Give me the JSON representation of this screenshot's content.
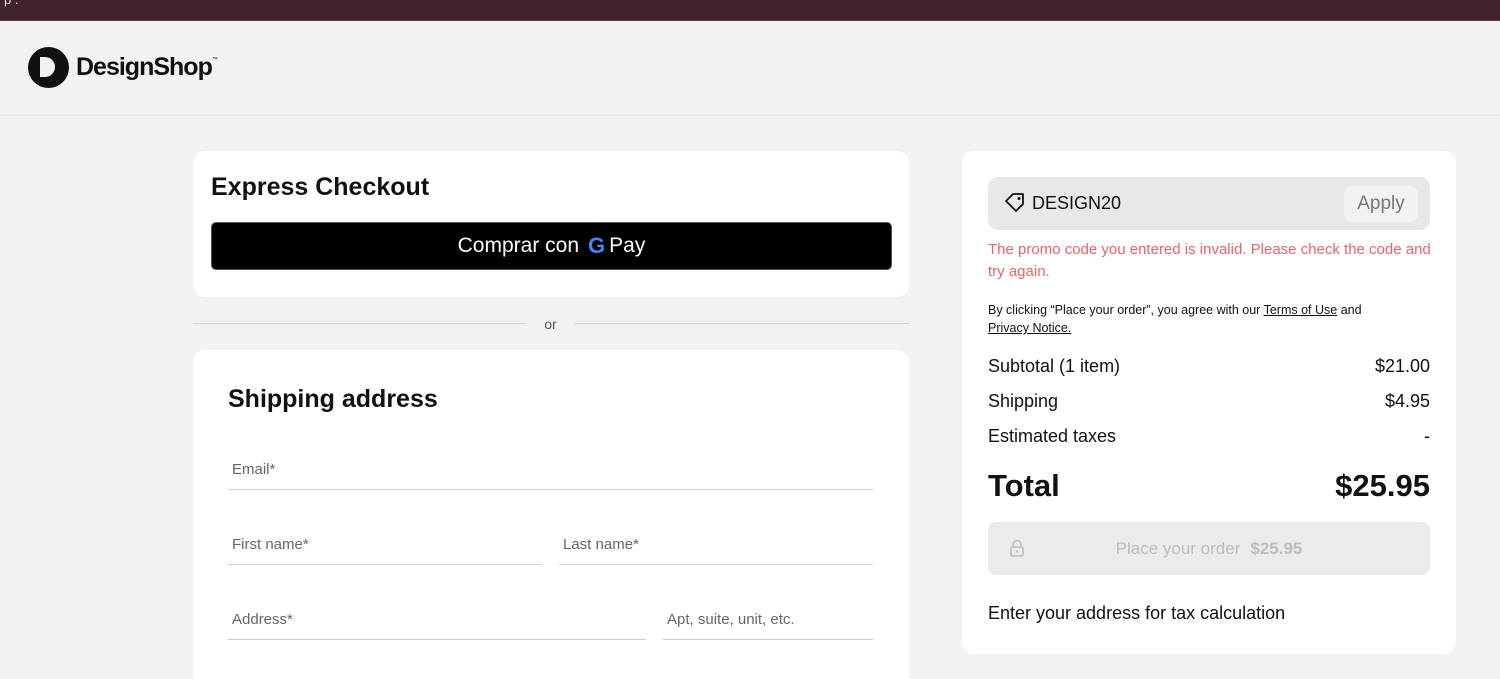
{
  "topbar": {
    "fragment": "p ."
  },
  "brand": {
    "name": "DesignShop",
    "tm": "™"
  },
  "express": {
    "title": "Express Checkout",
    "gpay_label": "Comprar con",
    "gpay_brand_g": "G",
    "gpay_brand_pay": "Pay"
  },
  "divider": {
    "label": "or"
  },
  "shipping": {
    "title": "Shipping address",
    "fields": {
      "email": {
        "placeholder": "Email*",
        "value": ""
      },
      "first_name": {
        "placeholder": "First name*",
        "value": ""
      },
      "last_name": {
        "placeholder": "Last name*",
        "value": ""
      },
      "address": {
        "placeholder": "Address*",
        "value": ""
      },
      "apt": {
        "placeholder": "Apt, suite, unit, etc.",
        "value": ""
      }
    }
  },
  "summary": {
    "promo": {
      "code": "DESIGN20",
      "apply_label": "Apply",
      "icon": "tag-icon"
    },
    "promo_error": "The promo code you entered is invalid. Please check the code and try again.",
    "terms": {
      "prefix": "By clicking “Place your order”, you agree with our",
      "terms_link": "Terms of Use",
      "and": "and",
      "privacy_link": "Privacy Notice."
    },
    "lines": [
      {
        "label": "Subtotal (1 item)",
        "value": "$21.00"
      },
      {
        "label": "Shipping",
        "value": "$4.95"
      },
      {
        "label": "Estimated taxes",
        "value": "-"
      }
    ],
    "total": {
      "label": "Total",
      "value": "$25.95"
    },
    "place_order": {
      "label": "Place your order",
      "amount": "$25.95",
      "icon": "lock-icon"
    },
    "tax_note": "Enter your address for tax calculation"
  },
  "colors": {
    "topbar": "#3f2329",
    "error": "#e8646a",
    "gpay_button": "#000000",
    "disabled_button": "#ebebeb"
  }
}
